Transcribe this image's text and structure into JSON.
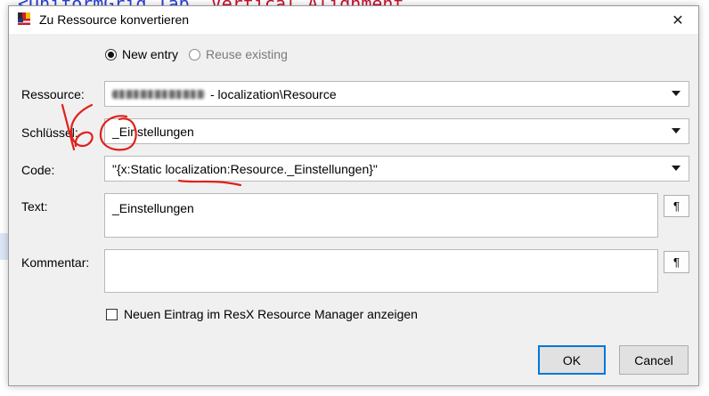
{
  "background": {
    "top_text_blue": "<UniformGrid.Tab",
    "top_text_red": "Vertical Alignment"
  },
  "dialog": {
    "title": "Zu Ressource konvertieren",
    "close_symbol": "✕",
    "mode": {
      "new_entry_label": "New entry",
      "reuse_existing_label": "Reuse existing",
      "selected": "new_entry"
    },
    "resource": {
      "label": "Ressource:",
      "value_suffix": "- localization\\Resource"
    },
    "key": {
      "label": "Schlüssel:",
      "value": "_Einstellungen"
    },
    "code": {
      "label": "Code:",
      "value": "\"{x:Static localization:Resource._Einstellungen}\""
    },
    "text": {
      "label": "Text:",
      "value": "_Einstellungen",
      "pilcrow": "¶"
    },
    "comment": {
      "label": "Kommentar:",
      "value": "",
      "pilcrow": "¶"
    },
    "show_in_manager": {
      "label": "Neuen Eintrag im ResX Resource Manager anzeigen",
      "checked": false
    },
    "buttons": {
      "ok": "OK",
      "cancel": "Cancel"
    }
  },
  "colors": {
    "accent": "#0078d7",
    "annotation": "#e0201b",
    "dialog_bg": "#f0f0f0"
  }
}
